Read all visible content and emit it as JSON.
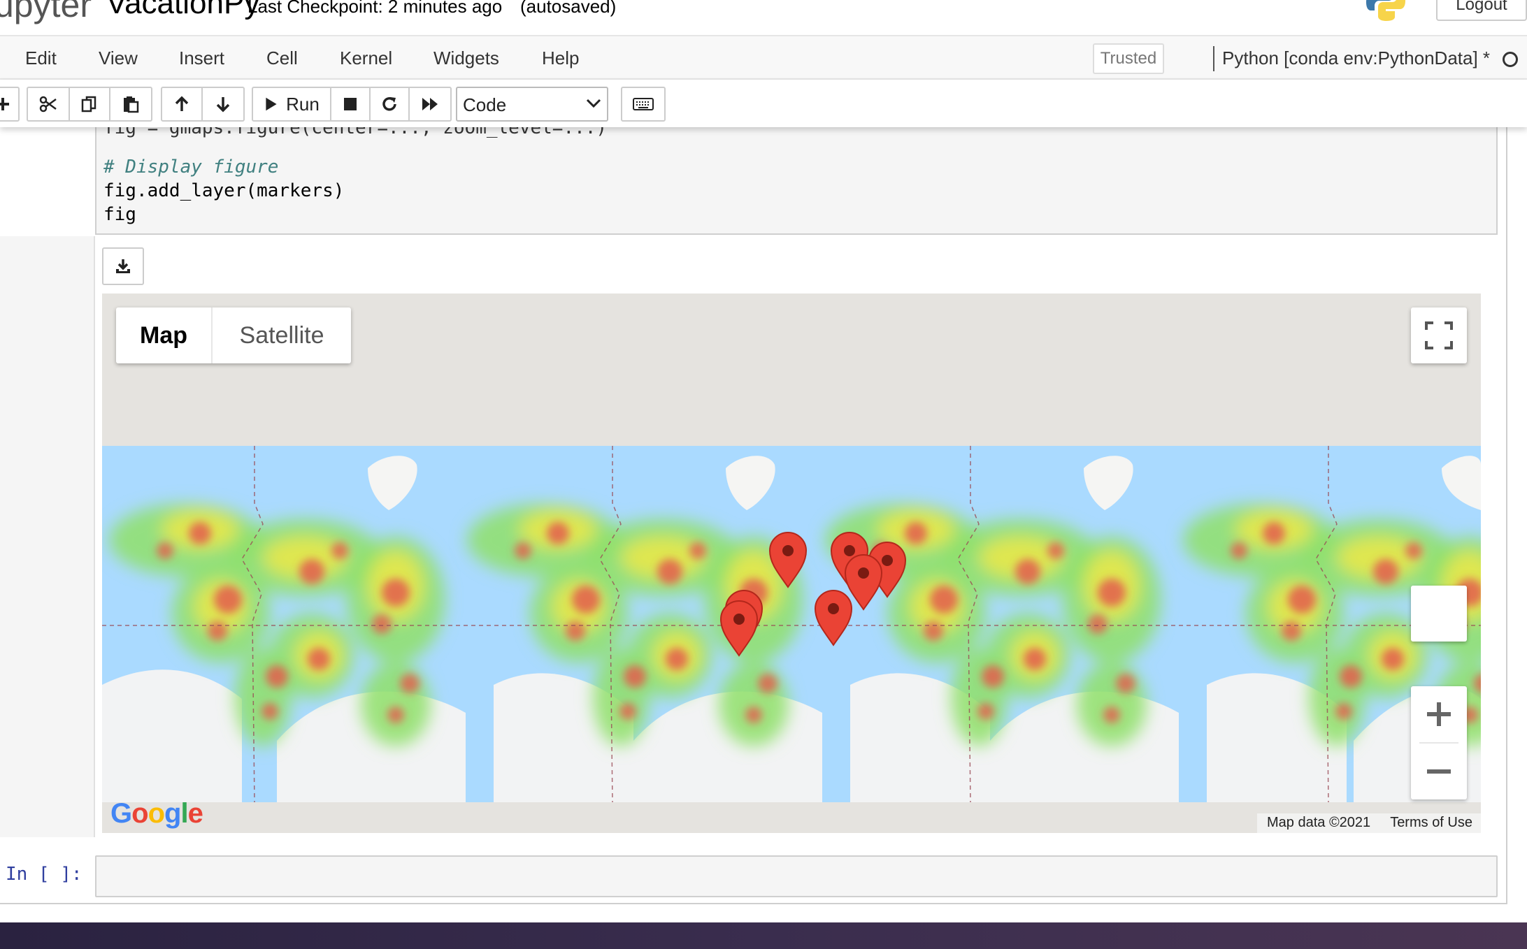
{
  "header": {
    "logo_text": "upyter",
    "notebook_name": "VacationPy",
    "checkpoint": "Last Checkpoint: 2 minutes ago",
    "autosave": "(autosaved)",
    "logout_label": "Logout"
  },
  "menubar": {
    "items": [
      "Edit",
      "View",
      "Insert",
      "Cell",
      "Kernel",
      "Widgets",
      "Help"
    ],
    "trusted_label": "Trusted",
    "kernel_name": "Python [conda env:PythonData] *"
  },
  "toolbar": {
    "run_label": "Run",
    "cell_type": "Code"
  },
  "code_cell": {
    "partial_line": "fig = gmaps.figure(center=..., zoom_level=...)",
    "comment": "# Display figure",
    "line2": "fig.add_layer(markers)",
    "line3": "fig"
  },
  "map": {
    "maptype_map": "Map",
    "maptype_satellite": "Satellite",
    "google_logo": "Google",
    "attribution_data": "Map data ©2021",
    "attribution_terms": "Terms of Use",
    "colors": {
      "ocean": "#aadaff",
      "land": "#f5f5f3",
      "polar": "#e9ecef",
      "background": "#e5e3df",
      "marker": "#ea4335",
      "marker_dot": "#7a1b12"
    }
  },
  "next_cell": {
    "prompt": "In [ ]:"
  }
}
